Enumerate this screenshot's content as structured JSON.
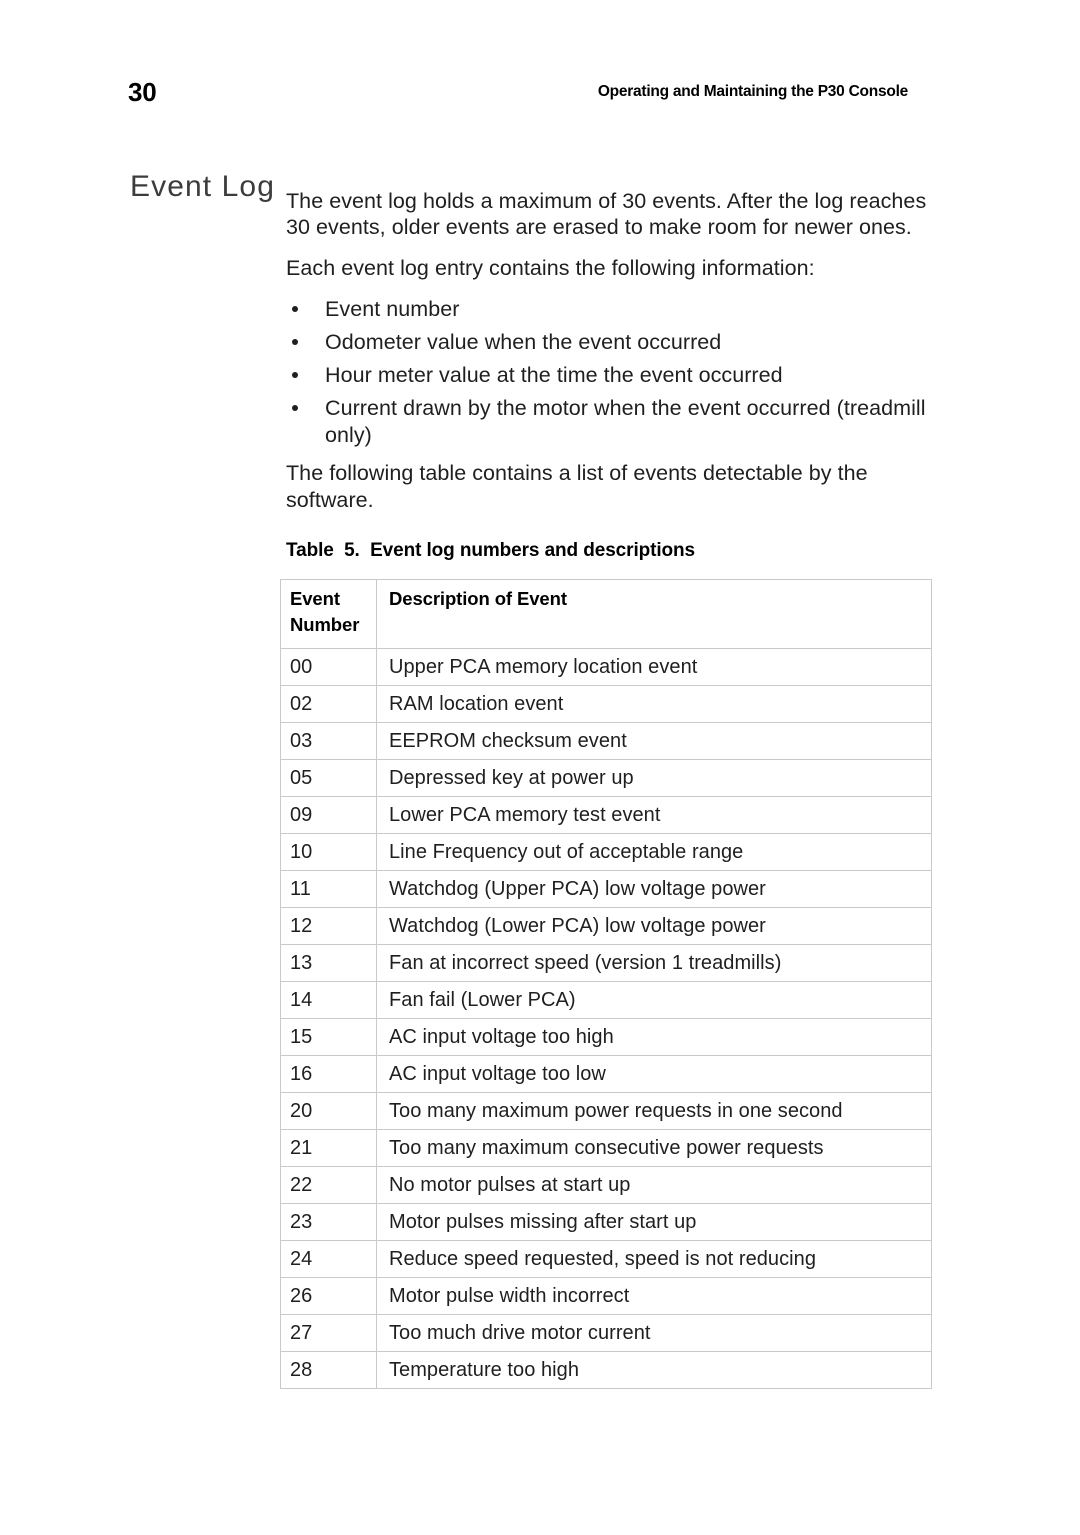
{
  "header": {
    "page_number": "30",
    "running_title": "Operating and Maintaining the P30 Console"
  },
  "section": {
    "heading": "Event Log"
  },
  "body": {
    "paragraph_1": "The event log holds a maximum of 30 events. After the log reaches 30 events, older events are erased to make room for newer ones.",
    "paragraph_2": "Each event log entry contains the following information:",
    "paragraph_3": "The following table contains a list of events detectable by the software.",
    "bullets": [
      "Event number",
      "Odometer value when the event occurred",
      "Hour meter value at the time the event occurred",
      "Current drawn by the motor when the event occurred (treadmill only)"
    ]
  },
  "table": {
    "caption": "Table  5.  Event log numbers and descriptions",
    "columns": {
      "event_number_line1": "Event",
      "event_number_line2": "Number",
      "description": "Description of Event"
    },
    "rows": [
      {
        "number": "00",
        "description": "Upper PCA memory location event"
      },
      {
        "number": "02",
        "description": "RAM location event"
      },
      {
        "number": "03",
        "description": "EEPROM checksum event"
      },
      {
        "number": "05",
        "description": "Depressed key at power up"
      },
      {
        "number": "09",
        "description": "Lower PCA memory test event"
      },
      {
        "number": "10",
        "description": "Line Frequency out of acceptable range"
      },
      {
        "number": "11",
        "description": "Watchdog (Upper PCA) low voltage power"
      },
      {
        "number": "12",
        "description": "Watchdog (Lower PCA) low voltage power"
      },
      {
        "number": "13",
        "description": "Fan at incorrect speed (version 1 treadmills)"
      },
      {
        "number": "14",
        "description": "Fan fail (Lower PCA)"
      },
      {
        "number": "15",
        "description": "AC input voltage too high"
      },
      {
        "number": "16",
        "description": "AC input voltage too low"
      },
      {
        "number": "20",
        "description": "Too many maximum power requests in one second"
      },
      {
        "number": "21",
        "description": "Too many maximum consecutive power requests"
      },
      {
        "number": "22",
        "description": "No motor pulses at start up"
      },
      {
        "number": "23",
        "description": "Motor pulses missing after start up"
      },
      {
        "number": "24",
        "description": "Reduce speed requested, speed is not reducing"
      },
      {
        "number": "26",
        "description": "Motor pulse width incorrect"
      },
      {
        "number": "27",
        "description": "Too much drive motor current"
      },
      {
        "number": "28",
        "description": "Temperature too high"
      }
    ]
  },
  "colors": {
    "page_background": "#ffffff",
    "body_text": "#1f1f1f",
    "heading_text": "#3c3c3c",
    "table_border": "#c9c9c9"
  }
}
